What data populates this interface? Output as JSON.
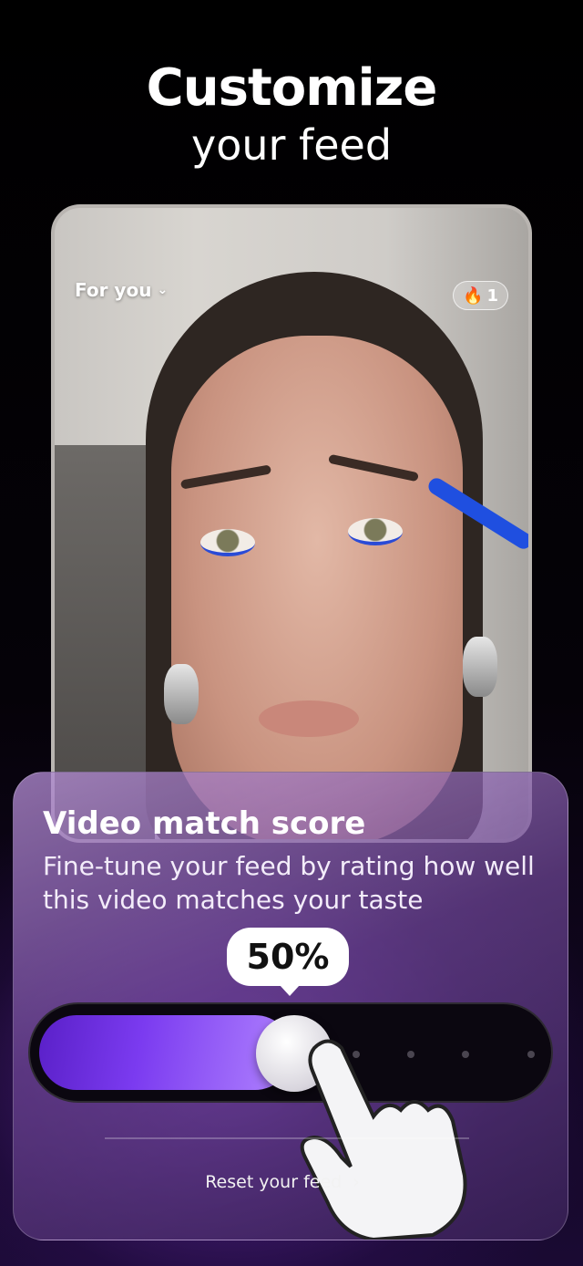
{
  "headline": {
    "line1": "Customize",
    "line2": "your feed"
  },
  "phone": {
    "feed_selector": "For you",
    "streak_icon": "fire-icon",
    "streak_count": "1"
  },
  "card": {
    "title": "Video match score",
    "subtitle": "Fine-tune your feed by rating how well this video matches your taste",
    "score_label": "50%",
    "score_value": 0.5,
    "reset_label": "Reset your feed"
  },
  "colors": {
    "accent": "#7b3bf0",
    "background": "#000000"
  }
}
